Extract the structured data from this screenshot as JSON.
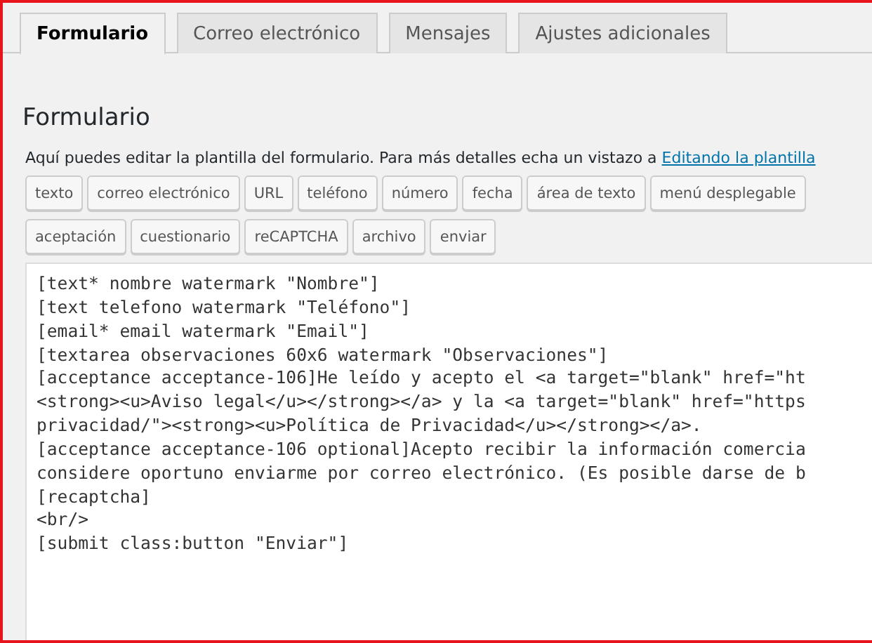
{
  "tabs": [
    {
      "label": "Formulario",
      "selected": true
    },
    {
      "label": "Correo electrónico",
      "selected": false
    },
    {
      "label": "Mensajes",
      "selected": false
    },
    {
      "label": "Ajustes adicionales",
      "selected": false
    }
  ],
  "heading": "Formulario",
  "description": {
    "text": "Aquí puedes editar la plantilla del formulario. Para más detalles echa un vistazo a ",
    "link": "Editando la plantilla"
  },
  "tag_buttons": [
    [
      "texto",
      "correo electrónico",
      "URL",
      "teléfono",
      "número",
      "fecha",
      "área de texto",
      "menú desplegable"
    ],
    [
      "aceptación",
      "cuestionario",
      "reCAPTCHA",
      "archivo",
      "enviar"
    ]
  ],
  "editor_lines": [
    "[text* nombre watermark \"Nombre\"]",
    "[text telefono watermark \"Teléfono\"]",
    "[email* email watermark \"Email\"]",
    "[textarea observaciones 60x6 watermark \"Observaciones\"]",
    "[acceptance acceptance-106]He leído y acepto el <a target=\"blank\" href=\"ht",
    "<strong><u>Aviso legal</u></strong></a> y la <a target=\"blank\" href=\"https",
    "privacidad/\"><strong><u>Política de Privacidad</u></strong></a>.",
    "[acceptance acceptance-106 optional]Acepto recibir la información comercia",
    "considere oportuno enviarme por correo electrónico. (Es posible darse de b",
    "[recaptcha]",
    "<br/>",
    "[submit class:button \"Enviar\"]"
  ]
}
